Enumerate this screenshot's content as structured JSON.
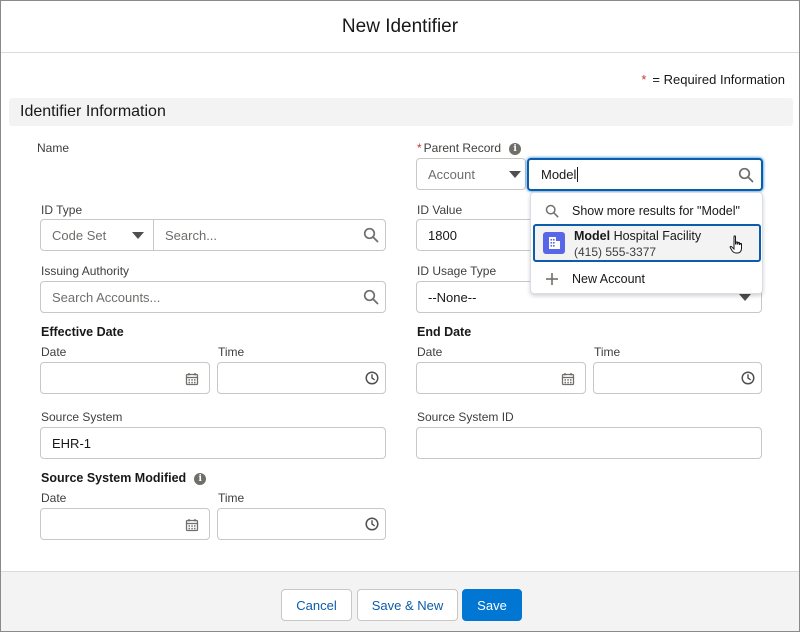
{
  "modal": {
    "title": "New Identifier"
  },
  "required_note": {
    "star": "*",
    "text": "= Required Information"
  },
  "section": {
    "title": "Identifier Information"
  },
  "fields": {
    "name": {
      "label": "Name"
    },
    "parent_record": {
      "label": "Parent Record",
      "required_star": "*",
      "type_value": "Account",
      "search_value": "Model"
    },
    "id_type": {
      "label": "ID Type",
      "type_value": "Code Set",
      "search_placeholder": "Search..."
    },
    "id_value": {
      "label": "ID Value",
      "value": "1800"
    },
    "issuing_authority": {
      "label": "Issuing Authority",
      "placeholder": "Search Accounts..."
    },
    "id_usage_type": {
      "label": "ID Usage Type",
      "value": "--None--"
    },
    "effective_date": {
      "label": "Effective Date",
      "date_label": "Date",
      "time_label": "Time"
    },
    "end_date": {
      "label": "End Date",
      "date_label": "Date",
      "time_label": "Time"
    },
    "source_system": {
      "label": "Source System",
      "value": "EHR-1"
    },
    "source_system_id": {
      "label": "Source System ID",
      "value": ""
    },
    "source_system_modified": {
      "label": "Source System Modified",
      "date_label": "Date",
      "time_label": "Time"
    }
  },
  "lookup_dropdown": {
    "show_more": "Show more results for \"Model\"",
    "result": {
      "match": "Model",
      "rest": " Hospital Facility",
      "subtitle": "(415) 555-3377"
    },
    "new_account": "New Account"
  },
  "footer": {
    "cancel": "Cancel",
    "save_new": "Save & New",
    "save": "Save"
  },
  "colors": {
    "brand": "#0176d3",
    "focus": "#0b5cab",
    "required": "#c23934",
    "account_icon": "#5867e8"
  }
}
